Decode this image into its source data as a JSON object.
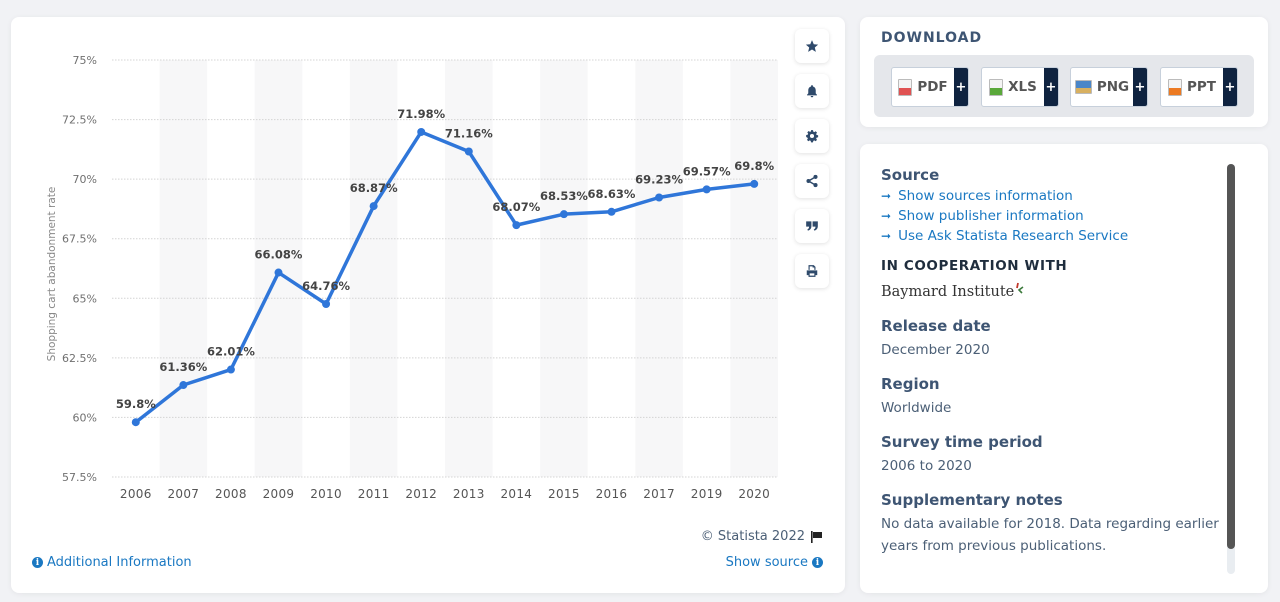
{
  "chart_data": {
    "type": "line",
    "title": "",
    "xlabel": "",
    "ylabel": "Shopping cart abandonment rate",
    "categories": [
      "2006",
      "2007",
      "2008",
      "2009",
      "2010",
      "2011",
      "2012",
      "2013",
      "2014",
      "2015",
      "2016",
      "2017",
      "2019",
      "2020"
    ],
    "series": [
      {
        "name": "Shopping cart abandonment rate",
        "values": [
          59.8,
          61.36,
          62.01,
          66.08,
          64.76,
          68.87,
          71.98,
          71.16,
          68.07,
          68.53,
          68.63,
          69.23,
          69.57,
          69.8
        ],
        "labels": [
          "59.8%",
          "61.36%",
          "62.01%",
          "66.08%",
          "64.76%",
          "68.87%",
          "71.98%",
          "71.16%",
          "68.07%",
          "68.53%",
          "68.63%",
          "69.23%",
          "69.57%",
          "69.8%"
        ],
        "color": "#2f76d9"
      }
    ],
    "ylim": [
      57.5,
      75
    ],
    "yticks": [
      57.5,
      60,
      62.5,
      65,
      67.5,
      70,
      72.5,
      75
    ],
    "ytick_labels": [
      "57.5%",
      "60%",
      "62.5%",
      "65%",
      "67.5%",
      "70%",
      "72.5%",
      "75%"
    ],
    "grid": true,
    "alternating_column_bands": true
  },
  "toolbar": {
    "buttons": [
      {
        "name": "favorite",
        "icon": "star-icon"
      },
      {
        "name": "notification",
        "icon": "bell-icon"
      },
      {
        "name": "settings",
        "icon": "gear-icon"
      },
      {
        "name": "share",
        "icon": "share-icon"
      },
      {
        "name": "cite",
        "icon": "quote-icon"
      },
      {
        "name": "print",
        "icon": "print-icon"
      }
    ]
  },
  "chart_footer": {
    "additional_info": "Additional Information",
    "copyright": "© Statista 2022",
    "show_source": "Show source"
  },
  "download": {
    "title": "DOWNLOAD",
    "formats": [
      {
        "label": "PDF",
        "color": "#e05252"
      },
      {
        "label": "XLS",
        "color": "#5aa83a"
      },
      {
        "label": "PNG",
        "color": "#4a86c8"
      },
      {
        "label": "PPT",
        "color": "#ec7a22"
      }
    ],
    "plus": "+"
  },
  "info": {
    "source_heading": "Source",
    "links": [
      "Show sources information",
      "Show publisher information",
      "Use Ask Statista Research Service"
    ],
    "arrow": "➞",
    "coop_heading": "IN COOPERATION WITH",
    "coop_partner": "Baymard Institute",
    "release_heading": "Release date",
    "release_value": "December 2020",
    "region_heading": "Region",
    "region_value": "Worldwide",
    "period_heading": "Survey time period",
    "period_value": "2006 to 2020",
    "notes_heading": "Supplementary notes",
    "notes_value": "No data available for 2018. Data regarding earlier years from previous publications."
  }
}
